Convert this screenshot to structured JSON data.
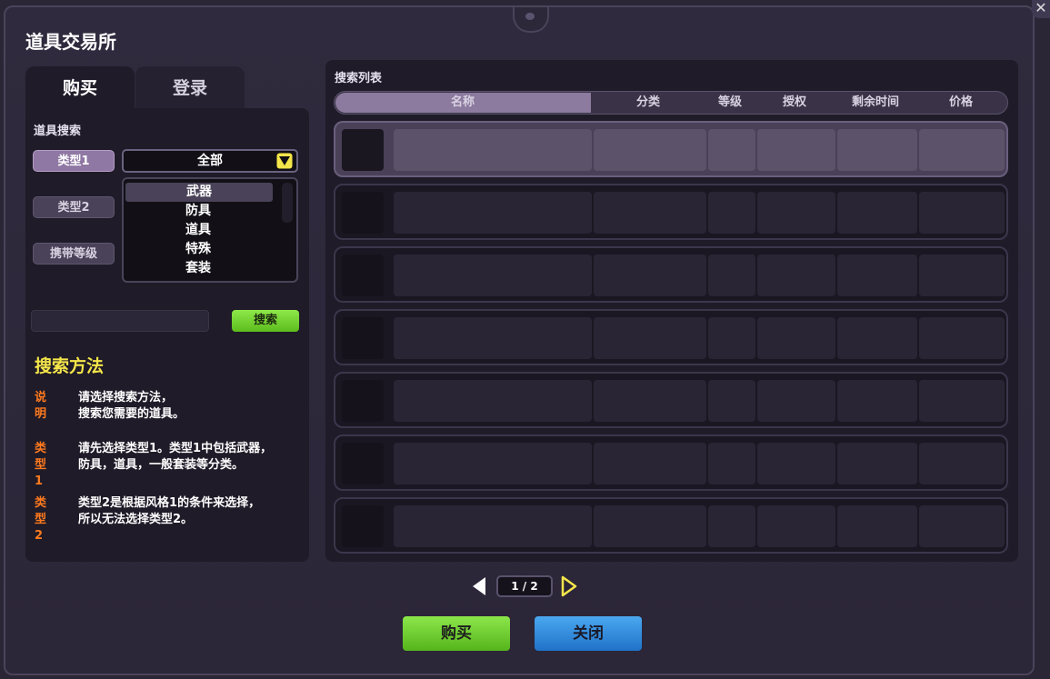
{
  "window": {
    "title": "道具交易所",
    "close_icon": "close-icon"
  },
  "tabs": [
    {
      "label": "购买",
      "active": true
    },
    {
      "label": "登录",
      "active": false
    }
  ],
  "search": {
    "section_label": "道具搜索",
    "filters": [
      {
        "label": "类型1",
        "active": true
      },
      {
        "label": "类型2",
        "active": false
      },
      {
        "label": "携带等级",
        "active": false
      }
    ],
    "dropdown_value": "全部",
    "dropdown_options": [
      "武器",
      "防具",
      "道具",
      "特殊",
      "套装"
    ],
    "input_value": "",
    "button_label": "搜索"
  },
  "method": {
    "title": "搜索方法",
    "items": [
      {
        "key": "说明",
        "text": "请选择搜索方法，\n搜索您需要的道具。"
      },
      {
        "key": "类型1",
        "text": "请先选择类型1。类型1中包括武器，\n防具，道具，一般套装等分类。"
      },
      {
        "key": "类型2",
        "text": "类型2是根据风格1的条件来选择，\n所以无法选择类型2。"
      }
    ]
  },
  "list": {
    "label": "搜索列表",
    "columns": [
      "名称",
      "分类",
      "等级",
      "授权",
      "剩余时间",
      "价格"
    ],
    "row_count": 7
  },
  "pager": {
    "text": "1 / 2"
  },
  "buttons": {
    "buy": "购买",
    "close": "关闭"
  },
  "colors": {
    "accent_purple": "#8f78a3",
    "buy_green": "#6fcf2e",
    "close_blue": "#3390e0",
    "method_title": "#f5e64a",
    "method_key": "#ff7a1e"
  }
}
